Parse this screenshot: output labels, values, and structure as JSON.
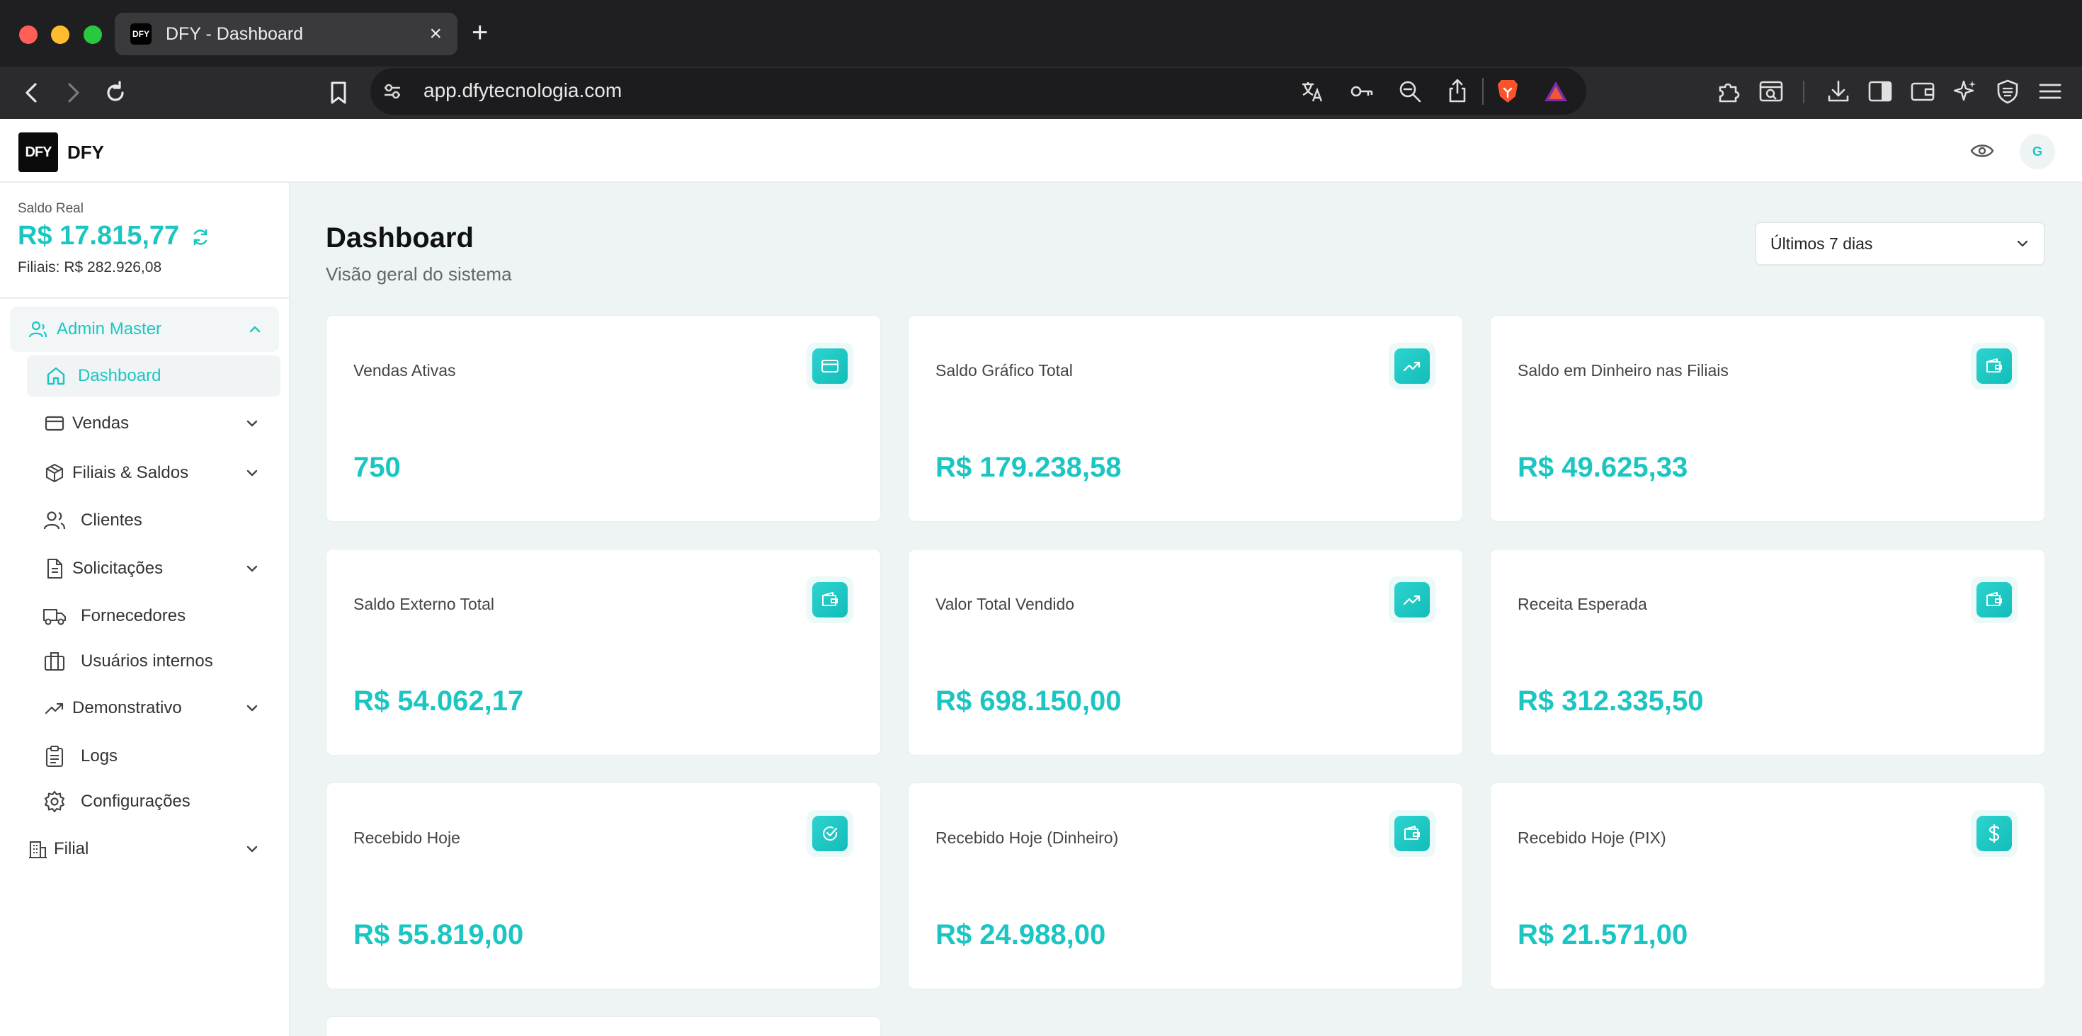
{
  "browser": {
    "tab_title": "DFY - Dashboard",
    "favicon_text": "DFY",
    "url": "app.dfytecnologia.com"
  },
  "app": {
    "brand": "DFY",
    "logo_text": "DFY",
    "avatar_initial": "G"
  },
  "sidebar": {
    "balance_label": "Saldo Real",
    "balance_value": "R$ 17.815,77",
    "branches_balance": "Filiais: R$ 282.926,08",
    "group_label": "Admin Master",
    "items": [
      {
        "label": "Dashboard",
        "icon": "home-icon",
        "active": true
      },
      {
        "label": "Vendas",
        "icon": "credit-card-icon",
        "expandable": true
      },
      {
        "label": "Filiais & Saldos",
        "icon": "package-icon",
        "expandable": true
      },
      {
        "label": "Clientes",
        "icon": "users-icon"
      },
      {
        "label": "Solicitações",
        "icon": "document-icon",
        "expandable": true
      },
      {
        "label": "Fornecedores",
        "icon": "truck-icon"
      },
      {
        "label": "Usuários internos",
        "icon": "briefcase-icon"
      },
      {
        "label": "Demonstrativo",
        "icon": "trending-up-icon",
        "expandable": true
      },
      {
        "label": "Logs",
        "icon": "clipboard-icon"
      },
      {
        "label": "Configurações",
        "icon": "gear-icon"
      }
    ],
    "filial_label": "Filial"
  },
  "main": {
    "title": "Dashboard",
    "subtitle": "Visão geral do sistema",
    "period": "Últimos 7 dias",
    "cards": [
      {
        "title": "Vendas Ativas",
        "value": "750",
        "icon": "credit-card-icon"
      },
      {
        "title": "Saldo Gráfico Total",
        "value": "R$ 179.238,58",
        "icon": "trending-up-icon"
      },
      {
        "title": "Saldo em Dinheiro nas Filiais",
        "value": "R$ 49.625,33",
        "icon": "wallet-icon"
      },
      {
        "title": "Saldo Externo Total",
        "value": "R$ 54.062,17",
        "icon": "wallet-icon"
      },
      {
        "title": "Valor Total Vendido",
        "value": "R$ 698.150,00",
        "icon": "trending-up-icon"
      },
      {
        "title": "Receita Esperada",
        "value": "R$ 312.335,50",
        "icon": "wallet-icon"
      },
      {
        "title": "Recebido Hoje",
        "value": "R$ 55.819,00",
        "icon": "check-circle-icon"
      },
      {
        "title": "Recebido Hoje (Dinheiro)",
        "value": "R$ 24.988,00",
        "icon": "wallet-icon"
      },
      {
        "title": "Recebido Hoje (PIX)",
        "value": "R$ 21.571,00",
        "icon": "dollar-icon"
      }
    ]
  },
  "colors": {
    "accent": "#1bc6c2",
    "background": "#eef3f4"
  }
}
